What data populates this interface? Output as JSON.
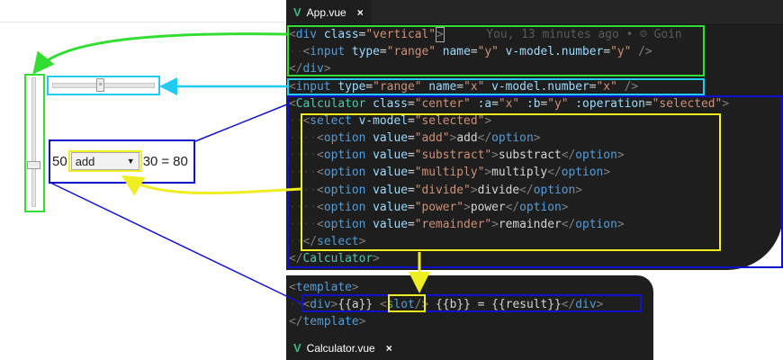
{
  "preview": {
    "slider_x_value": 50,
    "slider_y_value": 30,
    "calc": {
      "a": "50",
      "selected": "add",
      "b": "30",
      "equals": "=",
      "result": "80"
    }
  },
  "app_tab": {
    "title": "App.vue",
    "close": "×"
  },
  "calc_tab": {
    "title": "Calculator.vue",
    "close": "×"
  },
  "blame": "You, 13 minutes ago • ☺ Goin",
  "app_code": {
    "div_open_tag": "div",
    "div_class_attr": "class",
    "div_class_val": "\"vertical\"",
    "input_tag": "input",
    "type_attr": "type",
    "range_val": "\"range\"",
    "name_attr": "name",
    "y_val": "\"y\"",
    "x_val": "\"x\"",
    "vmodel_attr": "v-model.number",
    "div_close_tag": "div",
    "calc_tag": "Calculator",
    "class_attr": "class",
    "center_val": "\"center\"",
    "a_attr": ":a",
    "b_attr": ":b",
    "op_attr": ":operation",
    "sel_val": "\"selected\"",
    "select_tag": "select",
    "vmodel_plain": "v-model",
    "option_tag": "option",
    "value_attr": "value",
    "select_close_tag": "select",
    "calc_close_tag": "Calculator",
    "options": [
      {
        "value": "\"add\"",
        "label": "add"
      },
      {
        "value": "\"substract\"",
        "label": "substract"
      },
      {
        "value": "\"multiply\"",
        "label": "multiply"
      },
      {
        "value": "\"divide\"",
        "label": "divide"
      },
      {
        "value": "\"power\"",
        "label": "power"
      },
      {
        "value": "\"remainder\"",
        "label": "remainder"
      }
    ]
  },
  "calc_code": {
    "template_tag": "template",
    "div_tag": "div",
    "a_expr": "{{a}}",
    "slot_tag": "slot",
    "b_expr": "{{b}}",
    "equals": "=",
    "result_expr": "{{result}}"
  },
  "colors": {
    "green_box": "#33dd33",
    "cyan_box": "#22ccee",
    "blue_box": "#1111cc",
    "yellow_box": "#eeee22",
    "editor_bg": "#1e1e1e"
  }
}
